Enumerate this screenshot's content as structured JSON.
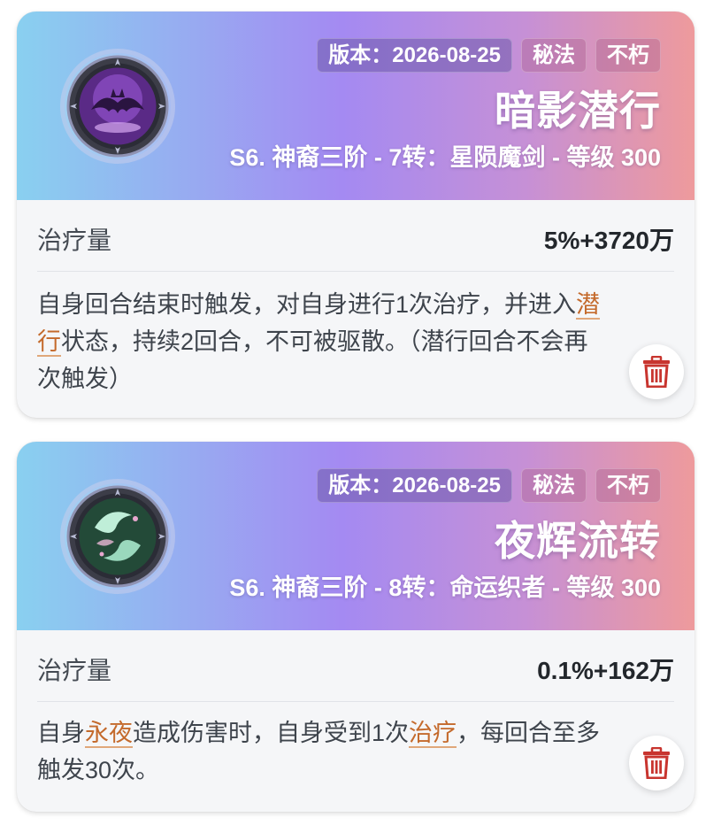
{
  "skills": [
    {
      "version_tag": "版本：2026-08-25",
      "tag_category": "秘法",
      "tag_trait": "不朽",
      "name": "暗影潜行",
      "source": "S6. 神裔三阶 - 7转：星陨魔剑 - 等级 300",
      "icon": "shadow-bat-icon",
      "stat_label": "治疗量",
      "stat_value": "5%+3720万",
      "desc_parts": [
        "自身回合结束时触发，对自身进行1次治疗，并进入",
        "潜行",
        "状态，持续2回合，不可被驱散。（潜行回合不会再次触发）"
      ],
      "delete_icon": "trash-icon"
    },
    {
      "version_tag": "版本：2026-08-25",
      "tag_category": "秘法",
      "tag_trait": "不朽",
      "name": "夜辉流转",
      "source": "S6. 神裔三阶 - 8转：命运织者 - 等级 300",
      "icon": "night-koi-icon",
      "stat_label": "治疗量",
      "stat_value": "0.1%+162万",
      "desc_parts": [
        "自身",
        "永夜",
        "造成伤害时，自身受到1次",
        "治疗",
        "，每回合至多触发30次。"
      ],
      "delete_icon": "trash-icon"
    }
  ],
  "colors": {
    "header_gradient": [
      "#89d0f0",
      "#a48af2",
      "#c690d6",
      "#ee9a9c"
    ],
    "keyword": "#c46a2c",
    "delete_red": "#c8352f"
  }
}
